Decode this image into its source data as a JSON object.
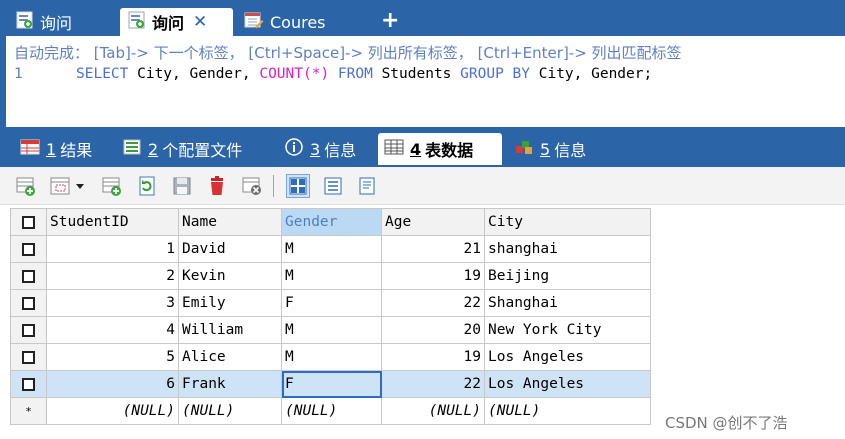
{
  "top_tabs": [
    {
      "label": "询问",
      "active": false
    },
    {
      "label": "询问",
      "active": true
    },
    {
      "label": "Coures",
      "active": false
    }
  ],
  "new_tab_label": "+",
  "editor": {
    "autocomplete_hint": "自动完成： [Tab]-> 下一个标签， [Ctrl+Space]-> 列出所有标签， [Ctrl+Enter]-> 列出匹配标签",
    "line_number": "1",
    "query": {
      "select": "SELECT",
      "fields": " City, Gender, ",
      "count": "COUNT(*)",
      "from": "FROM",
      "table": " Students ",
      "group_by": "GROUP BY",
      "group_fields": " City, Gender;"
    }
  },
  "result_tabs": [
    {
      "num": "1",
      "label": "结果"
    },
    {
      "num": "2",
      "label": "个配置文件"
    },
    {
      "num": "3",
      "label": "信息"
    },
    {
      "num": "4",
      "label": "表数据",
      "active": true
    },
    {
      "num": "5",
      "label": "信息"
    }
  ],
  "grid": {
    "columns": [
      "StudentID",
      "Name",
      "Gender",
      "Age",
      "City"
    ],
    "rows": [
      {
        "id": "1",
        "name": "David",
        "gender": "M",
        "age": "21",
        "city": "shanghai"
      },
      {
        "id": "2",
        "name": "Kevin",
        "gender": "M",
        "age": "19",
        "city": "Beijing"
      },
      {
        "id": "3",
        "name": "Emily",
        "gender": "F",
        "age": "22",
        "city": "Shanghai"
      },
      {
        "id": "4",
        "name": "William",
        "gender": "M",
        "age": "20",
        "city": "New York City"
      },
      {
        "id": "5",
        "name": "Alice",
        "gender": "M",
        "age": "19",
        "city": "Los Angeles"
      },
      {
        "id": "6",
        "name": "Frank",
        "gender": "F",
        "age": "22",
        "city": "Los Angeles"
      }
    ],
    "new_row_marker": "*",
    "null_text": "(NULL)"
  },
  "watermark": "CSDN @创不了浩",
  "colors": {
    "accent": "#2c64a8",
    "selection": "#cfe3f6",
    "keyword": "#4c6fd6",
    "function": "#e11ebc"
  }
}
